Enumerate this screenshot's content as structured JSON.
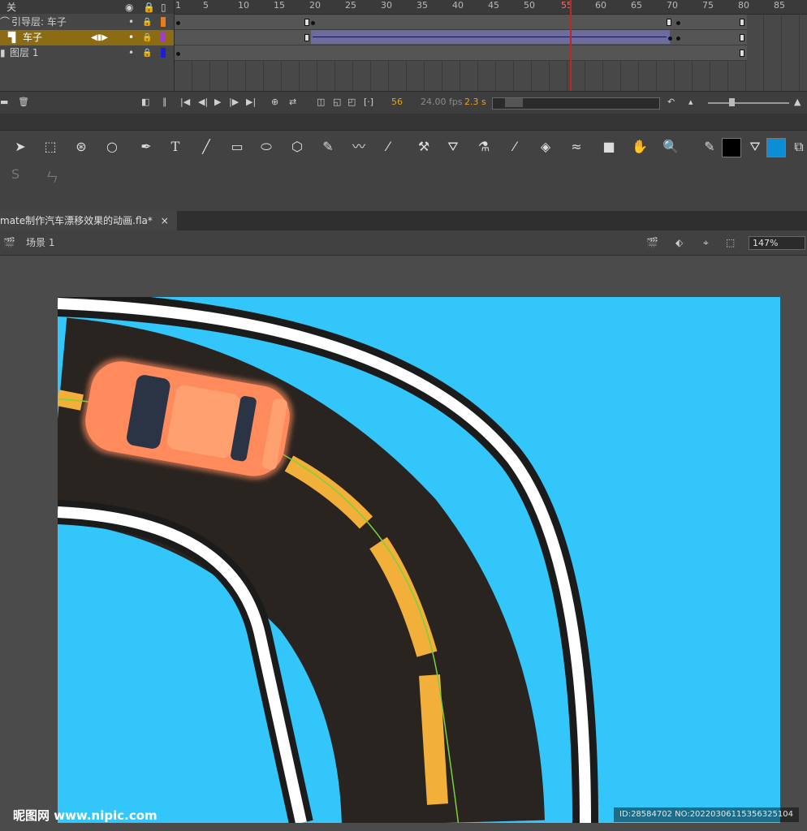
{
  "timeline": {
    "header_label": "关",
    "layers": [
      {
        "name": "引导层: 车子",
        "color": "#e87d17"
      },
      {
        "name": "车子",
        "color": "#9b3ed1"
      },
      {
        "name": "图层 1",
        "color": "#1d1dd6"
      }
    ],
    "ruler_ticks": [
      "1",
      "5",
      "10",
      "15",
      "20",
      "25",
      "30",
      "35",
      "40",
      "45",
      "50",
      "55",
      "60",
      "65",
      "70",
      "75",
      "80",
      "85"
    ],
    "current_frame": "56",
    "fps": "24.00 fps",
    "time": "2.3 s",
    "playhead_label": "55"
  },
  "tools": {
    "selection": "select-arrow-icon",
    "subselect": "free-transform-icon",
    "row2": [
      "S",
      "ㄣ"
    ]
  },
  "document": {
    "tab_title": "mate制作汽车漂移效果的动画.fla*",
    "tab_close": "×",
    "scene_label": "场景 1",
    "zoom": "147%"
  },
  "stage": {
    "background": "#33c6fb",
    "road_color": "#2a2420",
    "lane_color": "#f2b03a",
    "car_color": "#ff8a5c",
    "guide_color": "#7ad23a"
  },
  "watermark": {
    "site": "昵图网 www.nipic.com",
    "id": "ID:28584702 NO:20220306115356325104"
  }
}
